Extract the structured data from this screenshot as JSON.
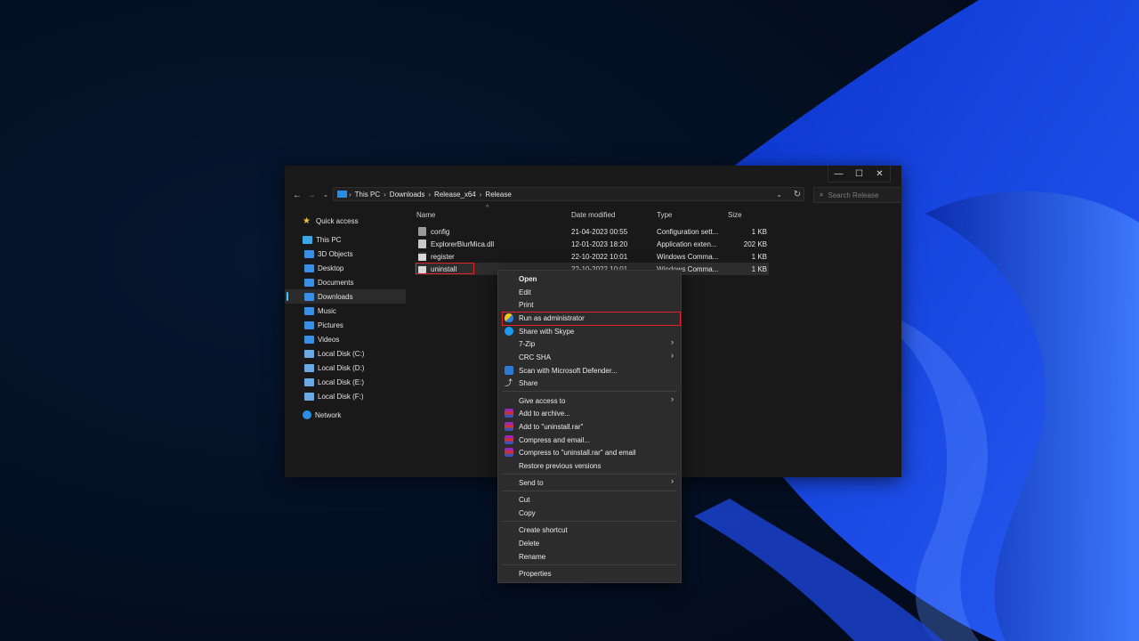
{
  "window": {
    "controls": {
      "minimize": "—",
      "maximize": "☐",
      "close": "✕"
    }
  },
  "address": {
    "breadcrumbs": [
      "This PC",
      "Downloads",
      "Release_x64",
      "Release"
    ],
    "search_placeholder": "Search Release"
  },
  "sidebar": {
    "quick_access": "Quick access",
    "this_pc": "This PC",
    "items": [
      "3D Objects",
      "Desktop",
      "Documents",
      "Downloads",
      "Music",
      "Pictures",
      "Videos",
      "Local Disk (C:)",
      "Local Disk (D:)",
      "Local Disk (E:)",
      "Local Disk (F:)"
    ],
    "selected": "Downloads",
    "network": "Network"
  },
  "file_list": {
    "columns": {
      "name": "Name",
      "date": "Date modified",
      "type": "Type",
      "size": "Size"
    },
    "files": [
      {
        "name": "config",
        "date": "21-04-2023 00:55",
        "type": "Configuration sett...",
        "size": "1 KB",
        "icon": "config-file-icon"
      },
      {
        "name": "ExplorerBlurMica.dll",
        "date": "12-01-2023 18:20",
        "type": "Application exten...",
        "size": "202 KB",
        "icon": "dll-file-icon"
      },
      {
        "name": "register",
        "date": "22-10-2022 10:01",
        "type": "Windows Comma...",
        "size": "1 KB",
        "icon": "cmd-file-icon"
      },
      {
        "name": "uninstall",
        "date": "22-10-2022 10:01",
        "type": "Windows Comma...",
        "size": "1 KB",
        "icon": "cmd-file-icon"
      }
    ],
    "selected": "uninstall"
  },
  "context_menu": {
    "items": [
      {
        "label": "Open",
        "bold": true
      },
      {
        "label": "Edit"
      },
      {
        "label": "Print"
      },
      {
        "label": "Run as administrator",
        "icon": "uac-shield-icon",
        "highlighted": true
      },
      {
        "label": "Share with Skype",
        "icon": "skype-icon"
      },
      {
        "label": "7-Zip",
        "submenu": true
      },
      {
        "label": "CRC SHA",
        "submenu": true
      },
      {
        "label": "Scan with Microsoft Defender...",
        "icon": "defender-icon"
      },
      {
        "label": "Share",
        "icon": "share-icon"
      },
      {
        "label": "Give access to",
        "submenu": true
      },
      {
        "label": "Add to archive...",
        "icon": "winrar-icon"
      },
      {
        "label": "Add to \"uninstall.rar\"",
        "icon": "winrar-icon"
      },
      {
        "label": "Compress and email...",
        "icon": "winrar-icon"
      },
      {
        "label": "Compress to \"uninstall.rar\" and email",
        "icon": "winrar-icon"
      },
      {
        "label": "Restore previous versions"
      },
      {
        "label": "Send to",
        "submenu": true
      },
      {
        "label": "Cut"
      },
      {
        "label": "Copy"
      },
      {
        "label": "Create shortcut"
      },
      {
        "label": "Delete"
      },
      {
        "label": "Rename"
      },
      {
        "label": "Properties"
      }
    ]
  },
  "colors": {
    "accent": "#4cc2ff",
    "highlight_border": "#e0232c",
    "wallpaper_blue": "#1535c8"
  }
}
